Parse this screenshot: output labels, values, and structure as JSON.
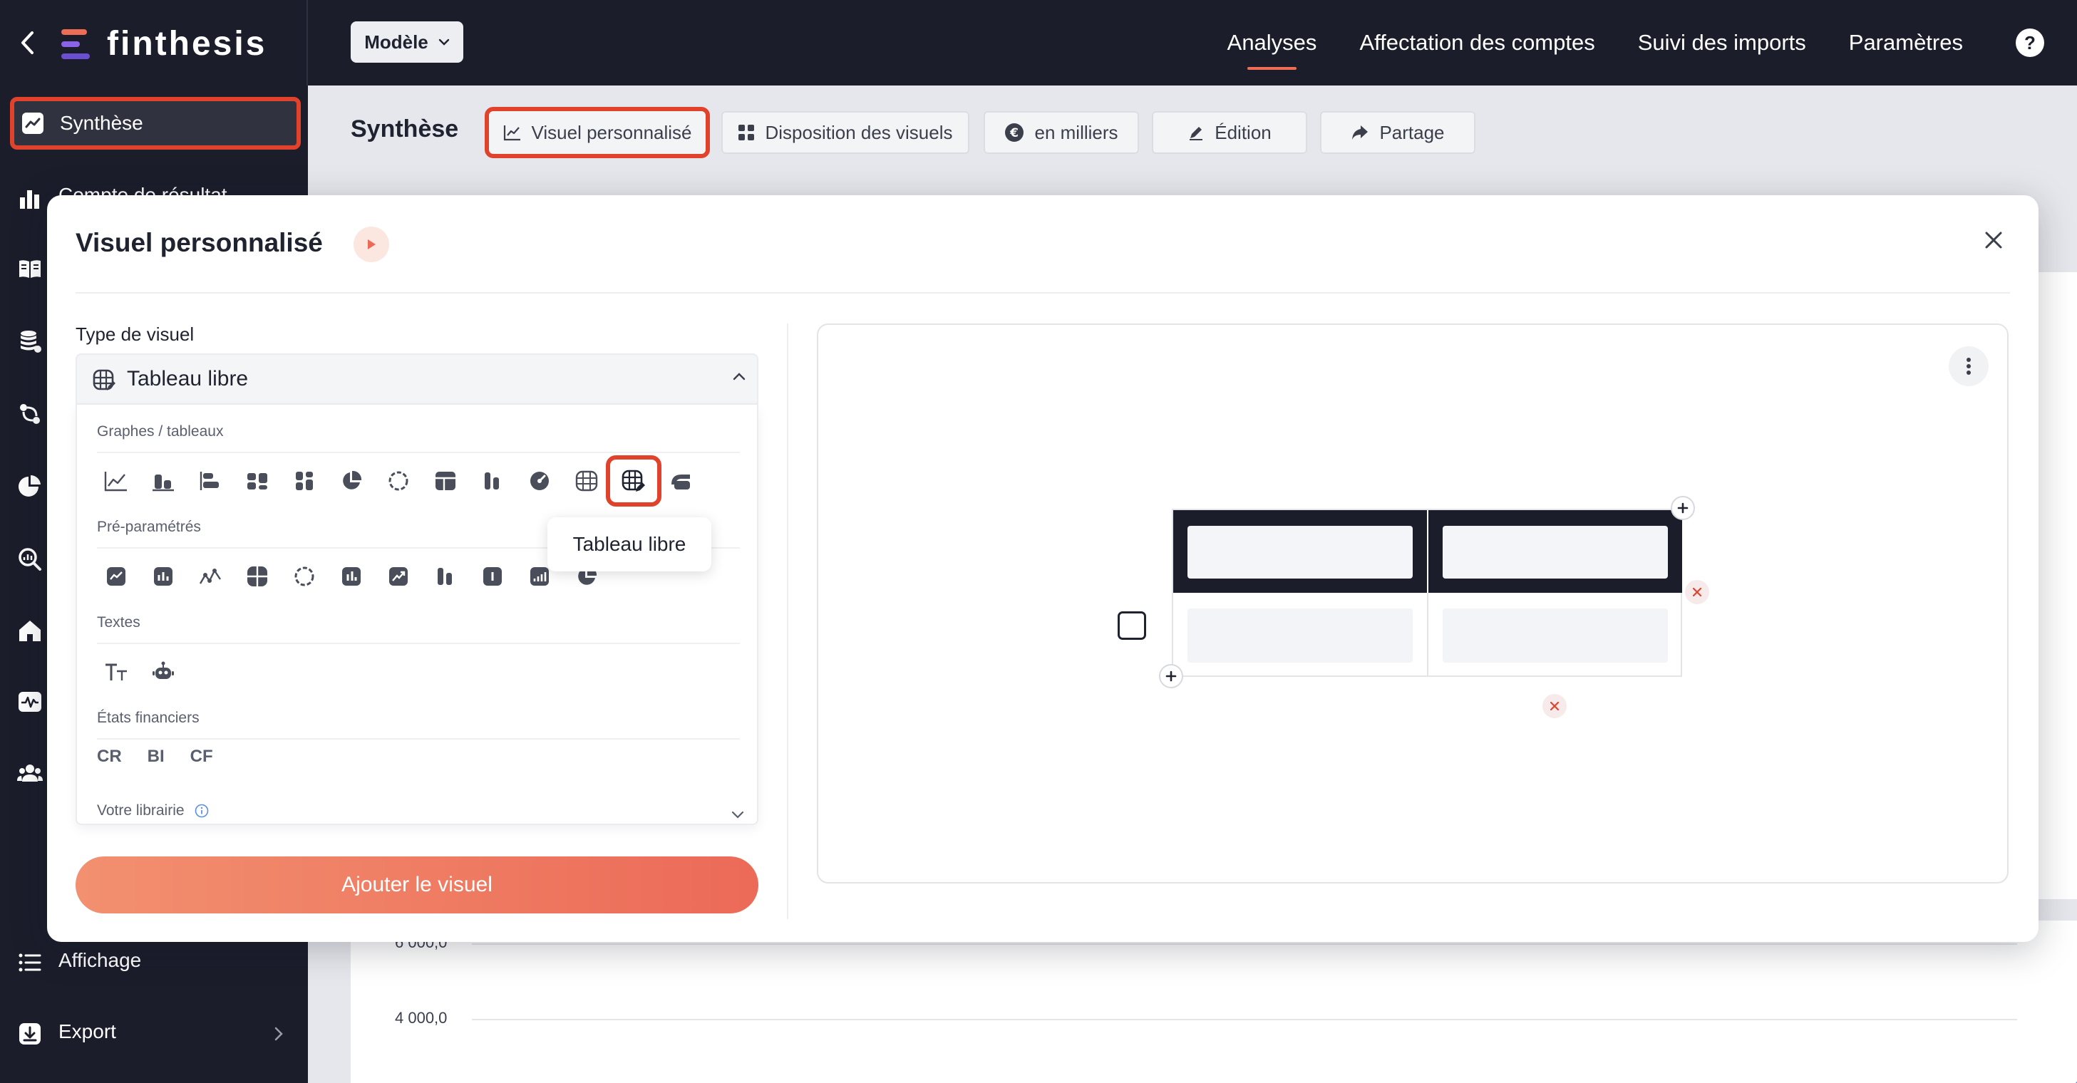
{
  "app": {
    "logo_text": "finthesis"
  },
  "header": {
    "model_label": "Modèle",
    "nav": [
      {
        "label": "Analyses",
        "active": true
      },
      {
        "label": "Affectation des comptes",
        "active": false
      },
      {
        "label": "Suivi des imports",
        "active": false
      },
      {
        "label": "Paramètres",
        "active": false
      }
    ],
    "help_label": "?"
  },
  "sidebar": {
    "active_item": "Synthèse",
    "partial_item": "Compte de résultat",
    "affichage": "Affichage",
    "export": "Export"
  },
  "main": {
    "title": "Synthèse",
    "toolbar": {
      "visuel": "Visuel personnalisé",
      "disposition": "Disposition des visuels",
      "milliers": "en milliers",
      "edition": "Édition",
      "partage": "Partage"
    },
    "chart_y_labels": [
      "6 000,0",
      "4 000,0"
    ]
  },
  "modal": {
    "title": "Visuel personnalisé",
    "type_label": "Type de visuel",
    "type_value": "Tableau libre",
    "sections": {
      "graphes": "Graphes / tableaux",
      "preparametres": "Pré-paramétrés",
      "textes": "Textes",
      "etats": "États financiers",
      "librairie": "Votre librairie"
    },
    "financial_states": [
      "CR",
      "BI",
      "CF"
    ],
    "tooltip": "Tableau libre",
    "add_button": "Ajouter le visuel"
  },
  "colors": {
    "accent": "#e0422c",
    "dark_bg": "#1b1d2b",
    "button_gradient_start": "#f2906f",
    "button_gradient_end": "#ec6a58"
  }
}
